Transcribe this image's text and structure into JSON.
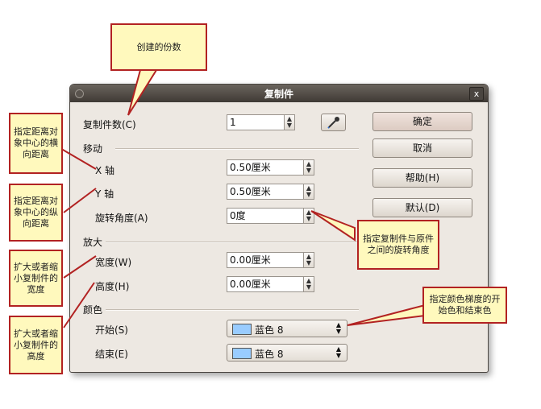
{
  "dialog": {
    "title": "复制件",
    "close_label": "x",
    "copies_label": "复制件数(C)",
    "copies_value": "1",
    "section_move": "移动",
    "x_label": "X 轴",
    "x_value": "0.50厘米",
    "y_label": "Y 轴",
    "y_value": "0.50厘米",
    "rotation_label": "旋转角度(A)",
    "rotation_value": "0度",
    "section_enlarge": "放大",
    "width_label": "宽度(W)",
    "width_value": "0.00厘米",
    "height_label": "高度(H)",
    "height_value": "0.00厘米",
    "section_color": "颜色",
    "start_label": "开始(S)",
    "start_value": "蓝色 8",
    "end_label": "结束(E)",
    "end_value": "蓝色 8",
    "swatch_color": "#99ccff",
    "buttons": {
      "ok": "确定",
      "cancel": "取消",
      "help": "帮助(H)",
      "default": "默认(D)"
    }
  },
  "annotations": {
    "copies": "创建的份数",
    "x_axis": "指定距离对象中心的横向距离",
    "y_axis": "指定距离对象中心的纵向距离",
    "width": "扩大或者缩小复制件的宽度",
    "height": "扩大或者缩小复制件的高度",
    "rotation": "指定复制件与原件之间的旋转角度",
    "color": "指定颜色梯度的开始色和结束色"
  }
}
